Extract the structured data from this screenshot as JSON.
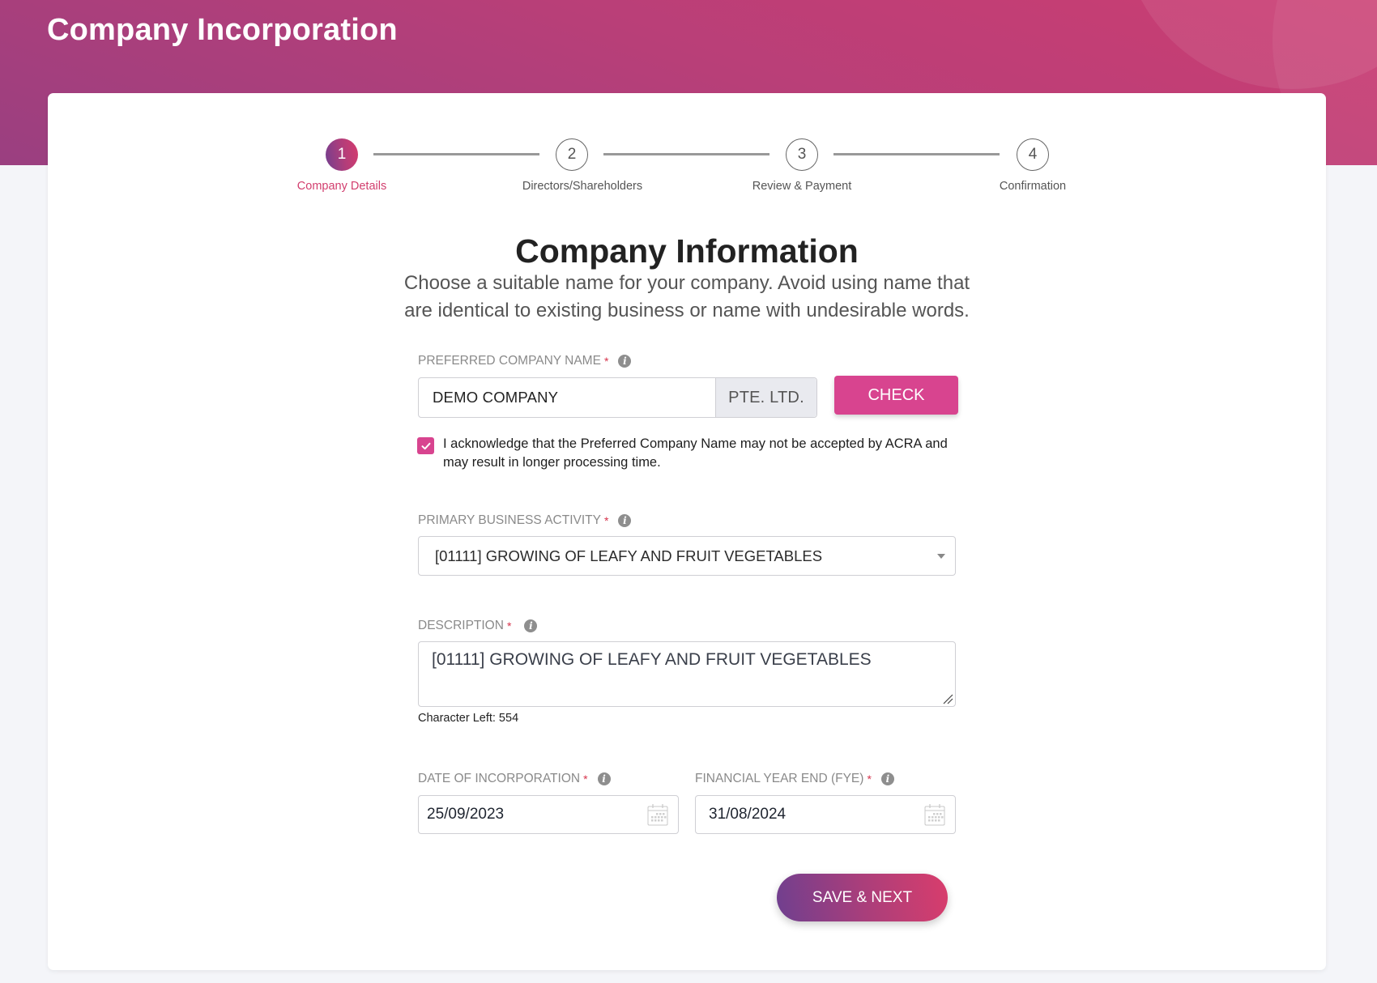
{
  "header": {
    "title": "Company Incorporation"
  },
  "stepper": {
    "steps": [
      {
        "number": "1",
        "label": "Company Details",
        "state": "active"
      },
      {
        "number": "2",
        "label": "Directors/Shareholders",
        "state": "pending"
      },
      {
        "number": "3",
        "label": "Review & Payment",
        "state": "pending"
      },
      {
        "number": "4",
        "label": "Confirmation",
        "state": "pending"
      }
    ]
  },
  "form": {
    "title": "Company Information",
    "subtitle": "Choose a suitable name for your company. Avoid using name that are identical to existing business or name with undesirable words.",
    "required_marker": "*",
    "info_icon_glyph": "i",
    "company_name": {
      "label": "PREFERRED COMPANY NAME",
      "value": "DEMO COMPANY",
      "suffix": "PTE. LTD.",
      "check_button": "CHECK"
    },
    "acknowledge": {
      "checked": true,
      "text": "I acknowledge that the Preferred Company Name may not be accepted by ACRA and may result in longer processing time."
    },
    "business_activity": {
      "label": "PRIMARY BUSINESS ACTIVITY",
      "selected": "[01111] GROWING OF LEAFY AND FRUIT VEGETABLES"
    },
    "description": {
      "label": "DESCRIPTION",
      "value": "[01111] GROWING OF LEAFY AND FRUIT VEGETABLES",
      "char_left": "Character Left: 554"
    },
    "date_of_incorporation": {
      "label": "DATE OF INCORPORATION",
      "value": "25/09/2023"
    },
    "financial_year_end": {
      "label": "FINANCIAL YEAR END (FYE)",
      "value": "31/08/2024"
    },
    "save_button": "SAVE & NEXT"
  },
  "colors": {
    "accent": "#d8448f",
    "active_step": "#d23e6e",
    "required": "#d6334b",
    "header_gradient_start": "#9a3f80",
    "header_gradient_end": "#cb3d72"
  }
}
